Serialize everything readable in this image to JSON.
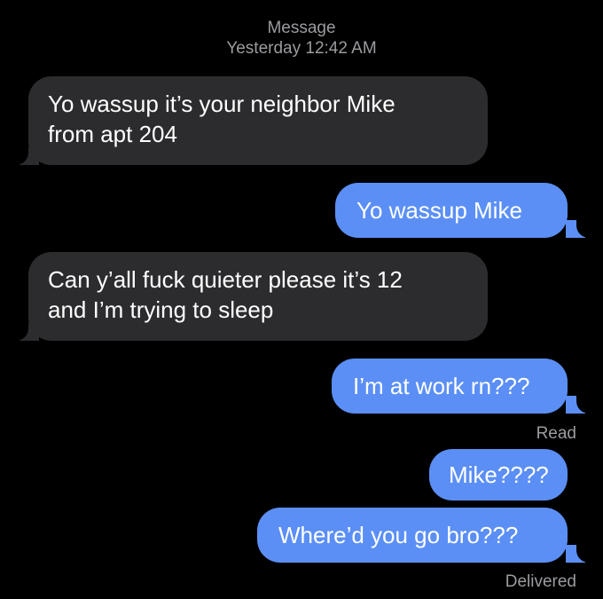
{
  "header": {
    "app_label": "Message",
    "timestamp": "Yesterday 12:42 AM"
  },
  "messages": [
    {
      "direction": "incoming",
      "lines": [
        "Yo wassup it’s your neighbor Mike",
        "from apt 204"
      ]
    },
    {
      "direction": "outgoing",
      "lines": [
        "Yo wassup Mike"
      ]
    },
    {
      "direction": "incoming",
      "lines": [
        "Can y’all fuck quieter please it’s 12",
        "and I’m trying to sleep"
      ]
    },
    {
      "direction": "outgoing",
      "lines": [
        "I’m at work rn???"
      ]
    },
    {
      "direction": "outgoing",
      "lines": [
        "Mike????"
      ]
    },
    {
      "direction": "outgoing",
      "lines": [
        "Where’d you go bro???"
      ]
    }
  ],
  "status": {
    "read": "Read",
    "delivered": "Delivered"
  },
  "colors": {
    "background": "#000000",
    "incoming_bubble": "#2c2c2f",
    "outgoing_bubble": "#5b8ff5",
    "meta_text": "#9b9ba0"
  }
}
